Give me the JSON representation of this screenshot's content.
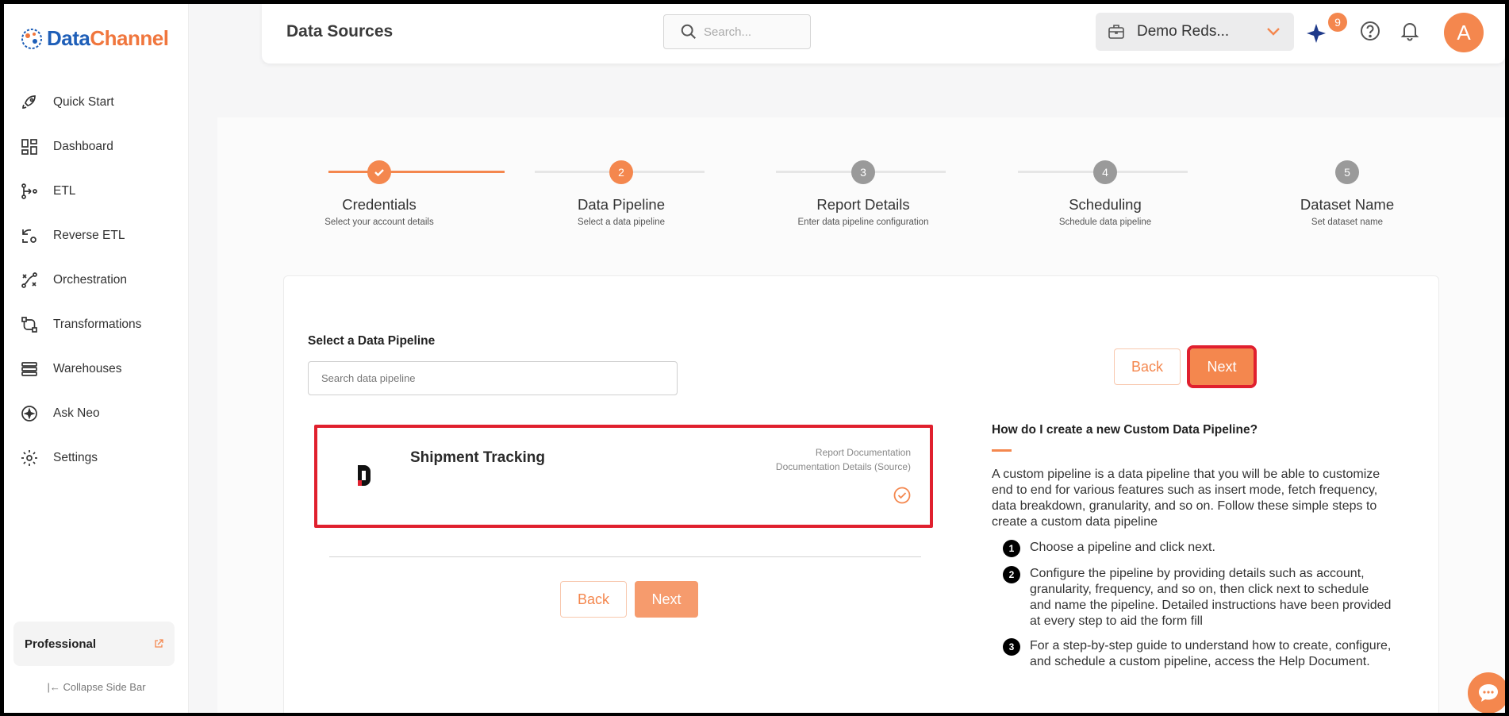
{
  "brand": {
    "logo_part1": "Data",
    "logo_part2": "Channel"
  },
  "sidebar": {
    "items": [
      {
        "label": "Quick Start",
        "icon": "rocket-icon"
      },
      {
        "label": "Dashboard",
        "icon": "dashboard-icon"
      },
      {
        "label": "ETL",
        "icon": "etl-icon"
      },
      {
        "label": "Reverse ETL",
        "icon": "reverse-etl-icon"
      },
      {
        "label": "Orchestration",
        "icon": "orchestration-icon"
      },
      {
        "label": "Transformations",
        "icon": "transformations-icon"
      },
      {
        "label": "Warehouses",
        "icon": "warehouse-icon"
      },
      {
        "label": "Ask Neo",
        "icon": "ask-neo-icon"
      },
      {
        "label": "Settings",
        "icon": "gear-icon"
      }
    ],
    "plan": "Professional",
    "collapse_label": "Collapse Side Bar"
  },
  "header": {
    "title": "Data Sources",
    "search_placeholder": "Search...",
    "workspace": "Demo Reds...",
    "notification_count": "9",
    "avatar_letter": "A"
  },
  "stepper": {
    "steps": [
      {
        "number": "1",
        "title": "Credentials",
        "subtitle": "Select your account details",
        "state": "done"
      },
      {
        "number": "2",
        "title": "Data Pipeline",
        "subtitle": "Select a data pipeline",
        "state": "active"
      },
      {
        "number": "3",
        "title": "Report Details",
        "subtitle": "Enter data pipeline configuration",
        "state": "pending"
      },
      {
        "number": "4",
        "title": "Scheduling",
        "subtitle": "Schedule data pipeline",
        "state": "pending"
      },
      {
        "number": "5",
        "title": "Dataset Name",
        "subtitle": "Set dataset name",
        "state": "pending"
      }
    ]
  },
  "form": {
    "select_label": "Select a Data Pipeline",
    "search_placeholder": "Search data pipeline",
    "back_label": "Back",
    "next_label": "Next"
  },
  "pipeline": {
    "name": "Shipment Tracking",
    "link_report": "Report Documentation",
    "link_docs": "Documentation Details (Source)"
  },
  "help": {
    "title": "How do I create a new Custom Data Pipeline?",
    "intro": "A custom pipeline is a data pipeline that you will be able to customize end to end for various features such as insert mode, fetch frequency, data breakdown, granularity, and so on. Follow these simple steps to create a custom data pipeline",
    "steps": [
      {
        "num": "1",
        "text": "Choose a pipeline and click next."
      },
      {
        "num": "2",
        "text": "Configure the pipeline by providing details such as account, granularity, frequency, and so on, then click next to schedule and name the pipeline. Detailed instructions have been provided at every step to aid the form fill"
      },
      {
        "num": "3",
        "text": "For a step-by-step guide to understand how to create, configure, and schedule a custom pipeline, access the Help Document."
      }
    ]
  },
  "colors": {
    "accent": "#f4874e",
    "highlight": "#e0202e",
    "brand_blue": "#1f5fb8"
  }
}
